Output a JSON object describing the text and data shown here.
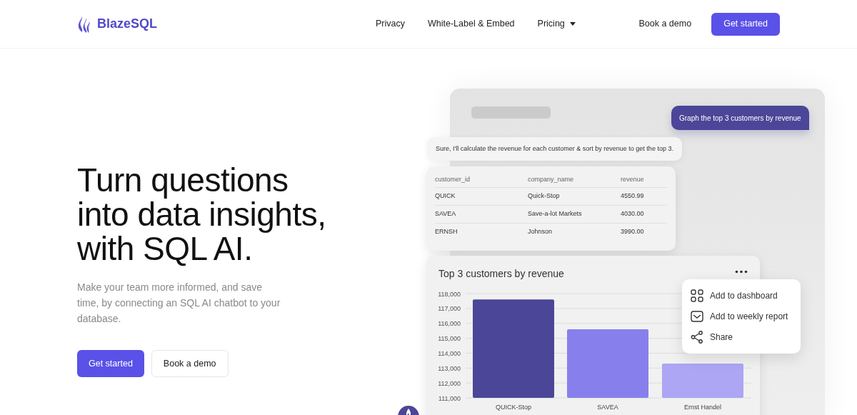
{
  "header": {
    "logo": "BlazeSQL",
    "nav": [
      {
        "label": "Privacy",
        "dropdown": false
      },
      {
        "label": "White-Label & Embed",
        "dropdown": false
      },
      {
        "label": "Pricing",
        "dropdown": true
      }
    ],
    "actions": [
      {
        "label": "Book a demo",
        "kind": "link"
      },
      {
        "label": "Get started",
        "kind": "primary"
      }
    ]
  },
  "hero": {
    "heading_lines": [
      "Turn questions",
      "into data insights,",
      "with SQL AI."
    ],
    "subtitle": "Make your team more informed, and save time, by connecting an SQL AI chatbot to your database.",
    "buttons": [
      {
        "label": "Get started",
        "kind": "primary"
      },
      {
        "label": "Book a demo",
        "kind": "secondary"
      }
    ]
  },
  "chat": {
    "user_message": "Graph the top 3 customers by revenue",
    "bot_message": "Sure, I'll calculate the revenue for each customer & sort by revenue to get the top 3.",
    "result_table": {
      "columns": [
        "customer_id",
        "company_name",
        "revenue"
      ],
      "rows": [
        [
          "QUICK",
          "Quick-Stop",
          "4550.99"
        ],
        [
          "SAVEA",
          "Save-a-lot Markets",
          "4030.00"
        ],
        [
          "ERNSH",
          "Johnson",
          "3990.00"
        ]
      ]
    },
    "chart_card": {
      "chart_data": {
        "type": "bar",
        "title": "Top 3 customers by revenue",
        "categories": [
          "QUICK-Stop",
          "SAVEA",
          "Ernst Handel"
        ],
        "series": [
          {
            "colors": [
              "#4b4697",
              "#8780ec",
              "#aca6f4"
            ],
            "values": [
              117600,
              115600,
              113300
            ]
          }
        ],
        "grid": true,
        "ylim": [
          111000,
          118000
        ],
        "yticks": [
          {
            "value": 111000,
            "label": "111,000"
          },
          {
            "value": 112000,
            "label": "112,000"
          },
          {
            "value": 113000,
            "label": "113,000"
          },
          {
            "value": 114000,
            "label": "114,000"
          },
          {
            "value": 115000,
            "label": "115,000"
          },
          {
            "value": 116000,
            "label": "116,000"
          },
          {
            "value": 117000,
            "label": "117,000"
          },
          {
            "value": 118000,
            "label": "118,000"
          }
        ]
      },
      "menu_items": [
        {
          "label": "Add to dashboard",
          "kind": "dashboard"
        },
        {
          "label": "Add to weekly report",
          "kind": "mail"
        },
        {
          "label": "Share",
          "kind": "share"
        }
      ]
    }
  }
}
